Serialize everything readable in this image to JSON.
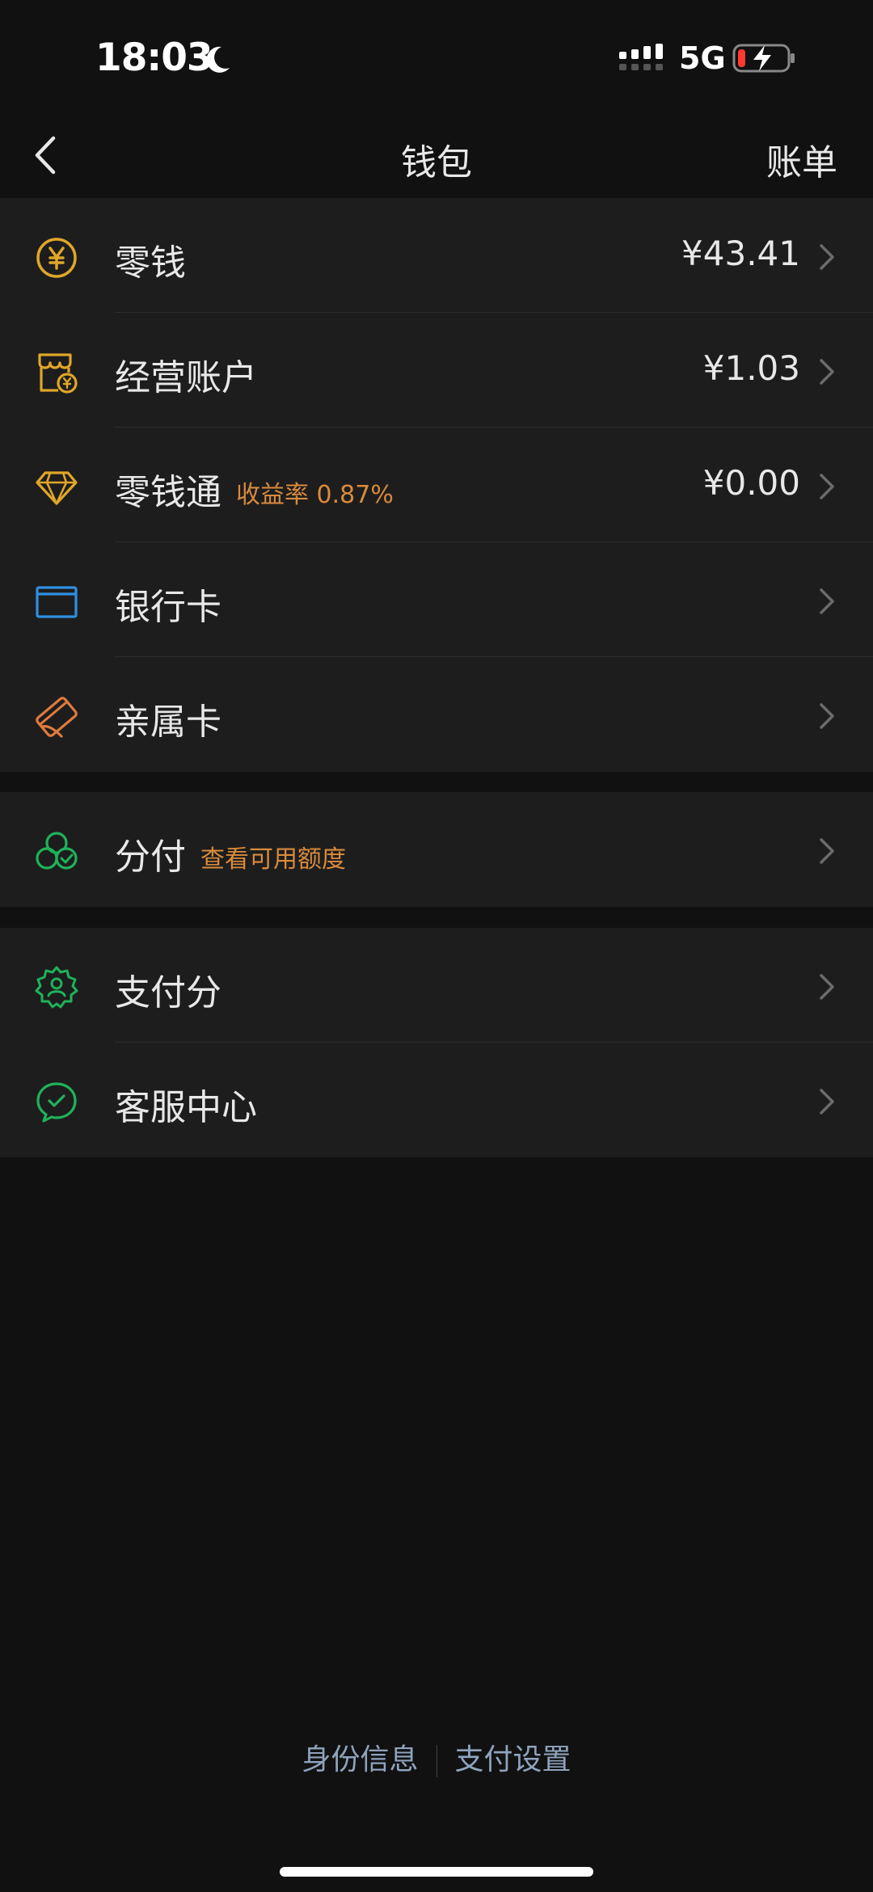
{
  "status_bar": {
    "time": "18:03",
    "network": "5G",
    "icons": [
      "moon-icon",
      "signal-icon",
      "battery-charging-icon"
    ]
  },
  "nav": {
    "title": "钱包",
    "right_label": "账单",
    "back_icon": "chevron-left-icon"
  },
  "groups": [
    {
      "items": [
        {
          "label": "零钱",
          "value": "¥43.41",
          "icon": "yuan-coin-icon",
          "icon_color": "#E0A628"
        },
        {
          "label": "经营账户",
          "value": "¥1.03",
          "icon": "store-account-icon",
          "icon_color": "#E0A628"
        },
        {
          "label": "零钱通",
          "tag": "收益率 0.87%",
          "value": "¥0.00",
          "icon": "diamond-icon",
          "icon_color": "#E0A628"
        },
        {
          "label": "银行卡",
          "icon": "bank-card-icon",
          "icon_color": "#2F8FE0"
        },
        {
          "label": "亲属卡",
          "icon": "family-card-icon",
          "icon_color": "#E07A3C"
        }
      ]
    },
    {
      "items": [
        {
          "label": "分付",
          "tag": "查看可用额度",
          "icon": "fenfu-icon",
          "icon_color": "#1FB25A"
        }
      ]
    },
    {
      "items": [
        {
          "label": "支付分",
          "icon": "payscore-badge-icon",
          "icon_color": "#1FB25A"
        },
        {
          "label": "客服中心",
          "icon": "customer-service-icon",
          "icon_color": "#1FB25A"
        }
      ]
    }
  ],
  "footer": {
    "links": [
      "身份信息",
      "支付设置"
    ]
  },
  "colors": {
    "background": "#111111",
    "section": "#1D1D1D",
    "tag": "#D98A3C",
    "footer_link": "#8FA3BD"
  }
}
